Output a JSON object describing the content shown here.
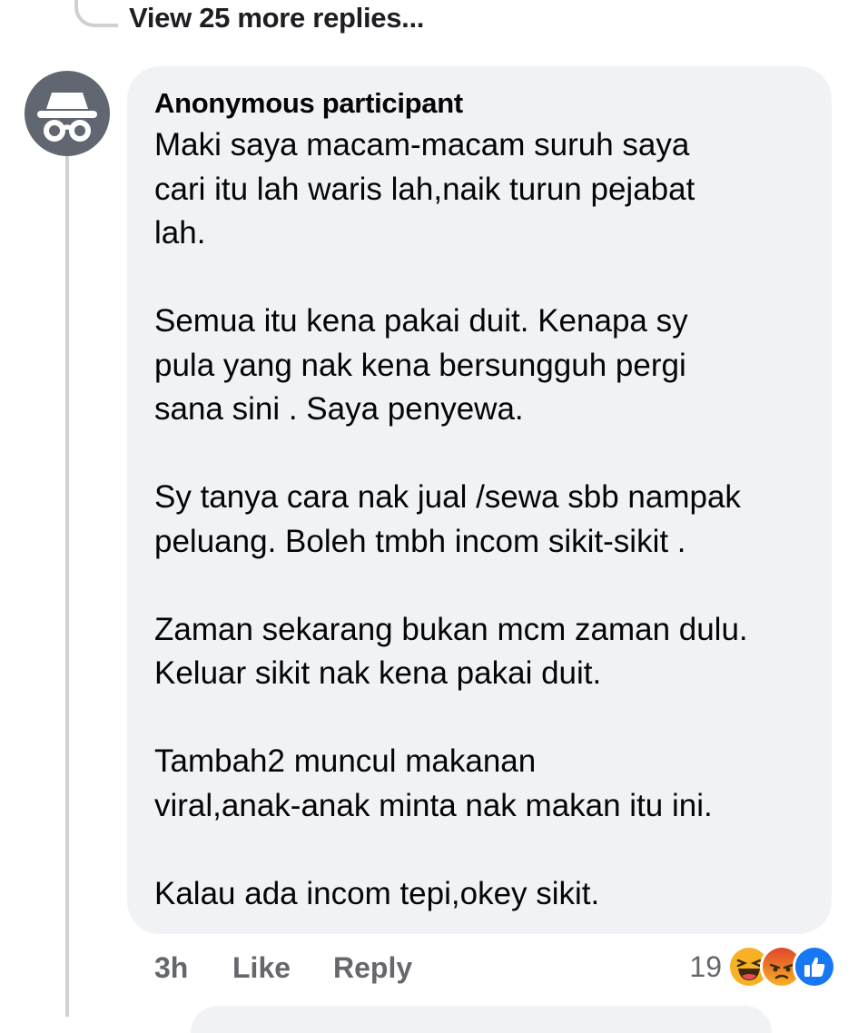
{
  "thread": {
    "view_more_label": "View 25 more replies..."
  },
  "comment": {
    "author": "Anonymous participant",
    "avatar_icon": "incognito-icon",
    "body_lines": [
      "Maki saya macam-macam suruh saya",
      "cari itu lah waris lah,naik turun pejabat",
      "lah.",
      "",
      "Semua itu kena pakai duit. Kenapa sy",
      "pula yang nak kena bersungguh pergi",
      "sana sini . Saya penyewa.",
      "",
      "Sy tanya cara nak jual /sewa sbb nampak",
      "peluang. Boleh tmbh incom sikit-sikit .",
      "",
      "Zaman sekarang bukan mcm zaman dulu.",
      "Keluar sikit nak kena pakai duit.",
      "",
      "Tambah2 muncul makanan",
      "viral,anak-anak minta nak makan itu ini.",
      "",
      "Kalau ada incom tepi,okey sikit."
    ],
    "time": "3h",
    "like_label": "Like",
    "reply_label": "Reply",
    "reaction_count": "19",
    "reactions": [
      "haha-icon",
      "angry-icon",
      "like-icon"
    ]
  },
  "colors": {
    "bubble_bg": "#f0f2f5",
    "meta_text": "#65676b",
    "thread_line": "#ced0d4",
    "like_blue": "#1877f2",
    "haha_yellow": "#f7b125",
    "angry_orange": "#e9710f"
  }
}
